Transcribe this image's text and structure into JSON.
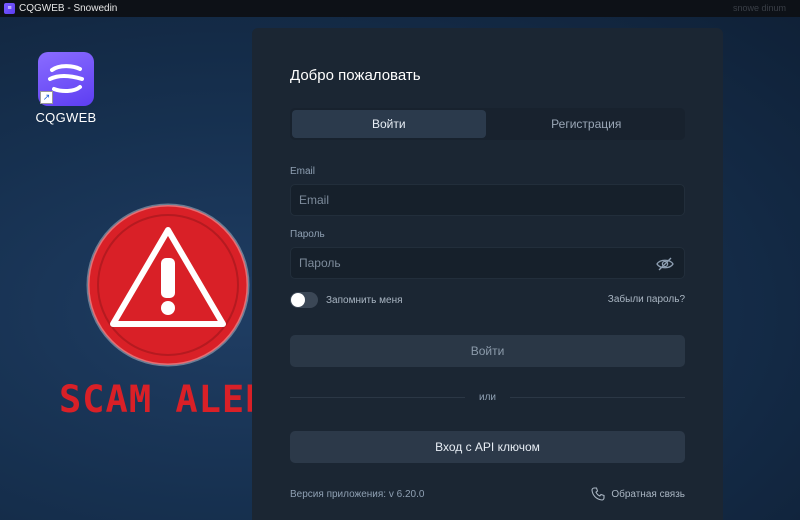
{
  "window": {
    "title": "CQGWEB - Snowedin",
    "app_icon": "cqgweb-logo-icon",
    "faint_right_text": "snowe dinum"
  },
  "desktop": {
    "icon_label": "CQGWEB",
    "icon": "cqgweb-logo-icon"
  },
  "overlay": {
    "scam_text": "SCAM ALERT",
    "color": "#d92027",
    "icon": "warning-triangle-icon"
  },
  "login": {
    "heading": "Добро пожаловать",
    "tabs": [
      {
        "label": "Войти",
        "active": true
      },
      {
        "label": "Регистрация",
        "active": false
      }
    ],
    "email_label": "Email",
    "email_placeholder": "Email",
    "password_label": "Пароль",
    "password_placeholder": "Пароль",
    "password_icon": "eye-slash-icon",
    "remember_label": "Запомнить меня",
    "remember_checked": false,
    "forgot_link": "Забыли пароль?",
    "login_button": "Войти",
    "or_text": "или",
    "api_button": "Вход с API ключом",
    "version_text": "Версия приложения: v 6.20.0",
    "feedback_link": "Обратная связь",
    "feedback_icon": "phone-icon"
  }
}
